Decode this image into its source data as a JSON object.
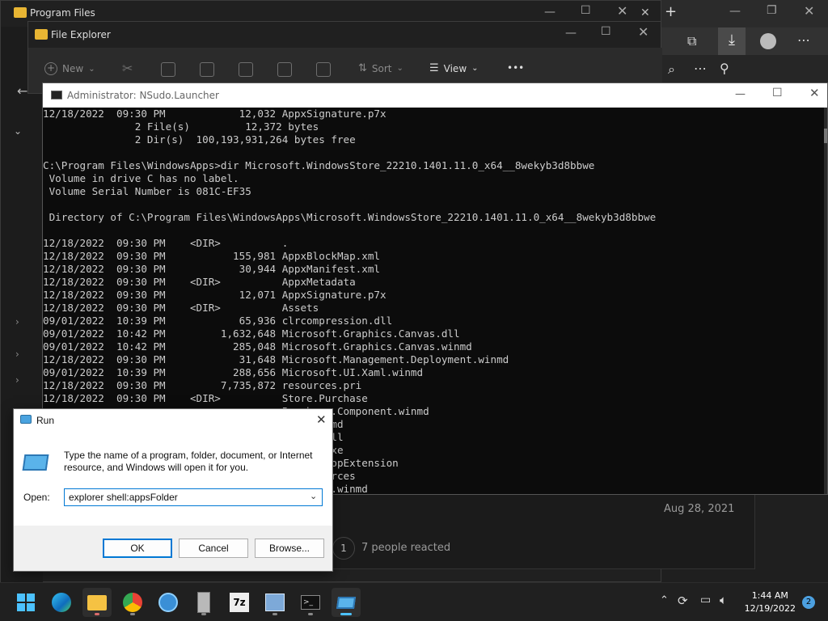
{
  "program_files": {
    "title": "Program Files"
  },
  "file_explorer": {
    "title": "File Explorer",
    "toolbar": {
      "new_label": "New",
      "sort_label": "Sort",
      "view_label": "View",
      "more_label": "•••"
    }
  },
  "console": {
    "title": "Administrator: NSudo.Launcher",
    "lines": [
      "12/18/2022  09:30 PM            12,032 AppxSignature.p7x",
      "               2 File(s)         12,372 bytes",
      "               2 Dir(s)  100,193,931,264 bytes free",
      "",
      "C:\\Program Files\\WindowsApps>dir Microsoft.WindowsStore_22210.1401.11.0_x64__8wekyb3d8bbwe",
      " Volume in drive C has no label.",
      " Volume Serial Number is 081C-EF35",
      "",
      " Directory of C:\\Program Files\\WindowsApps\\Microsoft.WindowsStore_22210.1401.11.0_x64__8wekyb3d8bbwe",
      "",
      "12/18/2022  09:30 PM    <DIR>          .",
      "12/18/2022  09:30 PM           155,981 AppxBlockMap.xml",
      "12/18/2022  09:30 PM            30,944 AppxManifest.xml",
      "12/18/2022  09:30 PM    <DIR>          AppxMetadata",
      "12/18/2022  09:30 PM            12,071 AppxSignature.p7x",
      "12/18/2022  09:30 PM    <DIR>          Assets",
      "09/01/2022  10:39 PM            65,936 clrcompression.dll",
      "09/01/2022  10:42 PM         1,632,648 Microsoft.Graphics.Canvas.dll",
      "09/01/2022  10:42 PM           285,048 Microsoft.Graphics.Canvas.winmd",
      "12/18/2022  09:30 PM            31,648 Microsoft.Management.Deployment.winmd",
      "09/01/2022  10:39 PM           288,656 Microsoft.UI.Xaml.winmd",
      "12/18/2022  09:30 PM         7,735,872 resources.pri",
      "12/18/2022  09:30 PM    <DIR>          Store.Purchase",
      "                                       Purchase.Component.winmd",
      "                                       sudk.winmd",
      "                                       re.App.dll",
      "                                       re.App.exe",
      "                                       re.DesktopExtension",
      "                                       re.Resources",
      "                                       re.Tasks.winmd"
    ]
  },
  "background_post": {
    "date": "Aug 28, 2021",
    "reaction_count": "1",
    "reacted_text": "7 people reacted"
  },
  "run_dialog": {
    "title": "Run",
    "description": "Type the name of a program, folder, document, or Internet resource, and Windows will open it for you.",
    "open_label": "Open:",
    "input_value": "explorer shell:appsFolder",
    "ok_label": "OK",
    "cancel_label": "Cancel",
    "browse_label": "Browse..."
  },
  "taskbar": {
    "time": "1:44 AM",
    "date": "12/19/2022",
    "notification_count": "2",
    "apps": [
      "start-icon",
      "edge-icon",
      "file-explorer-icon",
      "chrome-icon",
      "globe-app-icon",
      "archive-icon",
      "7zip-icon",
      "network-manager-icon",
      "terminal-icon",
      "run-icon"
    ]
  },
  "colors": {
    "accent": "#0078d4",
    "console_bg": "#0c0c0c",
    "console_text": "#cccccc",
    "taskbar_bg": "#202020"
  }
}
